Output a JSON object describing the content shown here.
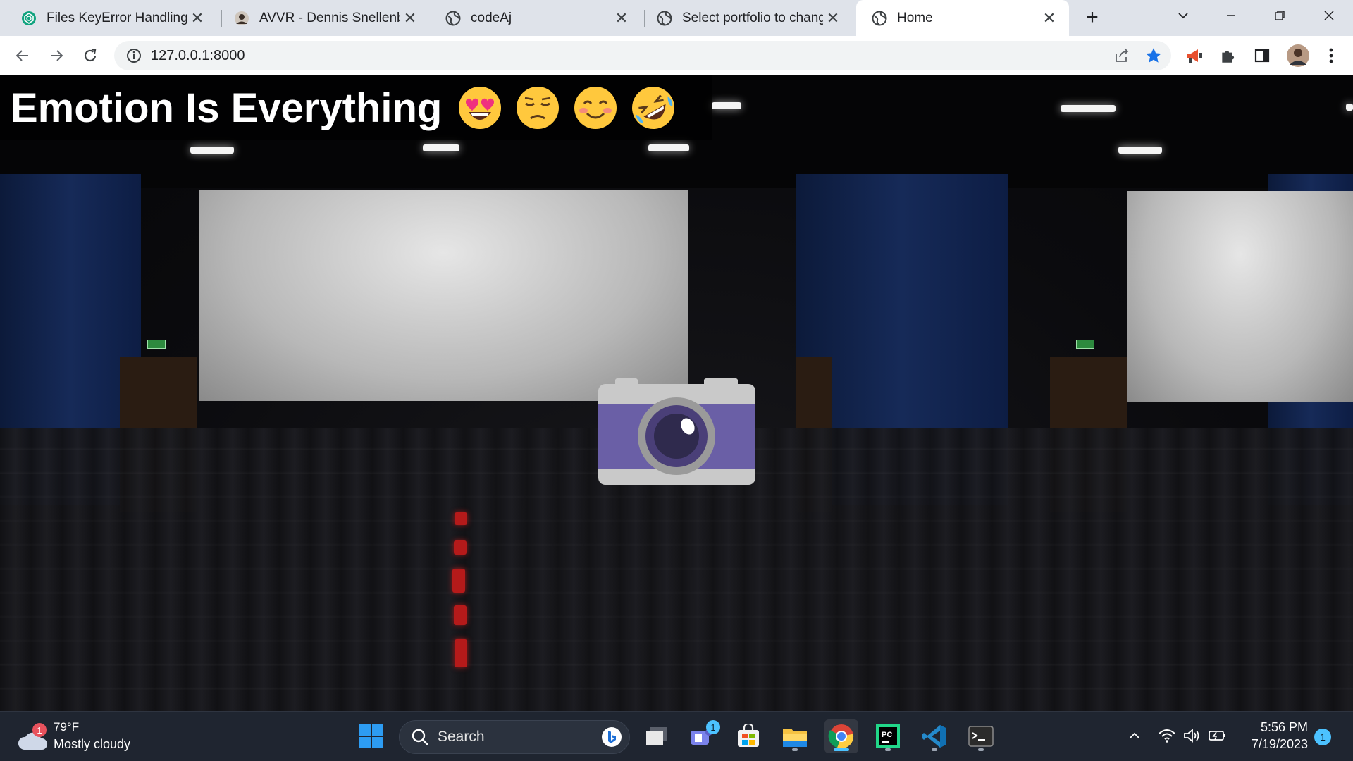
{
  "browser": {
    "tabs": [
      {
        "title": "Files KeyError Handling",
        "icon": "openai-icon",
        "active": false
      },
      {
        "title": "AVVR - Dennis Snellenberg",
        "icon": "avatar-icon",
        "active": false
      },
      {
        "title": "codeAj",
        "icon": "globe-icon",
        "active": false
      },
      {
        "title": "Select portfolio to change",
        "icon": "globe-icon",
        "active": false
      },
      {
        "title": "Home",
        "icon": "globe-icon",
        "active": true
      }
    ],
    "close_glyph": "✕",
    "new_tab_glyph": "+",
    "url": "127.0.0.1:8000",
    "bookmarked": true,
    "accent": "#1a73e8"
  },
  "page": {
    "title": "Emotion Is Everything",
    "emojis": [
      "heart-eyes-emoji",
      "disappointed-emoji",
      "smiling-blush-emoji",
      "rolling-laughing-emoji"
    ],
    "background": "cinema-auditorium",
    "center_icon": "camera-icon"
  },
  "taskbar": {
    "weather": {
      "temp": "79°F",
      "condition": "Mostly cloudy",
      "badge": "1"
    },
    "search_label": "Search",
    "teams_badge": "1",
    "apps": [
      "task-view-icon",
      "teams-icon",
      "store-icon",
      "file-explorer-icon",
      "chrome-icon",
      "pycharm-icon",
      "vscode-icon",
      "terminal-icon"
    ],
    "clock": {
      "time": "5:56 PM",
      "date": "7/19/2023"
    },
    "notification_count": "1"
  }
}
